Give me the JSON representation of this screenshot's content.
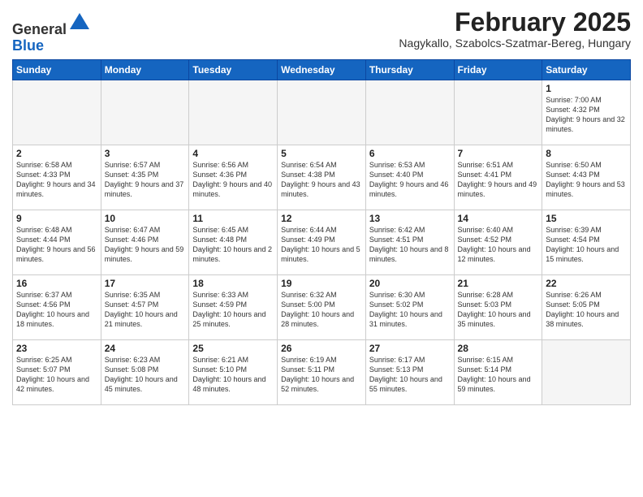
{
  "logo": {
    "general": "General",
    "blue": "Blue"
  },
  "header": {
    "title": "February 2025",
    "subtitle": "Nagykallo, Szabolcs-Szatmar-Bereg, Hungary"
  },
  "weekdays": [
    "Sunday",
    "Monday",
    "Tuesday",
    "Wednesday",
    "Thursday",
    "Friday",
    "Saturday"
  ],
  "weeks": [
    [
      {
        "day": "",
        "info": ""
      },
      {
        "day": "",
        "info": ""
      },
      {
        "day": "",
        "info": ""
      },
      {
        "day": "",
        "info": ""
      },
      {
        "day": "",
        "info": ""
      },
      {
        "day": "",
        "info": ""
      },
      {
        "day": "1",
        "info": "Sunrise: 7:00 AM\nSunset: 4:32 PM\nDaylight: 9 hours and 32 minutes."
      }
    ],
    [
      {
        "day": "2",
        "info": "Sunrise: 6:58 AM\nSunset: 4:33 PM\nDaylight: 9 hours and 34 minutes."
      },
      {
        "day": "3",
        "info": "Sunrise: 6:57 AM\nSunset: 4:35 PM\nDaylight: 9 hours and 37 minutes."
      },
      {
        "day": "4",
        "info": "Sunrise: 6:56 AM\nSunset: 4:36 PM\nDaylight: 9 hours and 40 minutes."
      },
      {
        "day": "5",
        "info": "Sunrise: 6:54 AM\nSunset: 4:38 PM\nDaylight: 9 hours and 43 minutes."
      },
      {
        "day": "6",
        "info": "Sunrise: 6:53 AM\nSunset: 4:40 PM\nDaylight: 9 hours and 46 minutes."
      },
      {
        "day": "7",
        "info": "Sunrise: 6:51 AM\nSunset: 4:41 PM\nDaylight: 9 hours and 49 minutes."
      },
      {
        "day": "8",
        "info": "Sunrise: 6:50 AM\nSunset: 4:43 PM\nDaylight: 9 hours and 53 minutes."
      }
    ],
    [
      {
        "day": "9",
        "info": "Sunrise: 6:48 AM\nSunset: 4:44 PM\nDaylight: 9 hours and 56 minutes."
      },
      {
        "day": "10",
        "info": "Sunrise: 6:47 AM\nSunset: 4:46 PM\nDaylight: 9 hours and 59 minutes."
      },
      {
        "day": "11",
        "info": "Sunrise: 6:45 AM\nSunset: 4:48 PM\nDaylight: 10 hours and 2 minutes."
      },
      {
        "day": "12",
        "info": "Sunrise: 6:44 AM\nSunset: 4:49 PM\nDaylight: 10 hours and 5 minutes."
      },
      {
        "day": "13",
        "info": "Sunrise: 6:42 AM\nSunset: 4:51 PM\nDaylight: 10 hours and 8 minutes."
      },
      {
        "day": "14",
        "info": "Sunrise: 6:40 AM\nSunset: 4:52 PM\nDaylight: 10 hours and 12 minutes."
      },
      {
        "day": "15",
        "info": "Sunrise: 6:39 AM\nSunset: 4:54 PM\nDaylight: 10 hours and 15 minutes."
      }
    ],
    [
      {
        "day": "16",
        "info": "Sunrise: 6:37 AM\nSunset: 4:56 PM\nDaylight: 10 hours and 18 minutes."
      },
      {
        "day": "17",
        "info": "Sunrise: 6:35 AM\nSunset: 4:57 PM\nDaylight: 10 hours and 21 minutes."
      },
      {
        "day": "18",
        "info": "Sunrise: 6:33 AM\nSunset: 4:59 PM\nDaylight: 10 hours and 25 minutes."
      },
      {
        "day": "19",
        "info": "Sunrise: 6:32 AM\nSunset: 5:00 PM\nDaylight: 10 hours and 28 minutes."
      },
      {
        "day": "20",
        "info": "Sunrise: 6:30 AM\nSunset: 5:02 PM\nDaylight: 10 hours and 31 minutes."
      },
      {
        "day": "21",
        "info": "Sunrise: 6:28 AM\nSunset: 5:03 PM\nDaylight: 10 hours and 35 minutes."
      },
      {
        "day": "22",
        "info": "Sunrise: 6:26 AM\nSunset: 5:05 PM\nDaylight: 10 hours and 38 minutes."
      }
    ],
    [
      {
        "day": "23",
        "info": "Sunrise: 6:25 AM\nSunset: 5:07 PM\nDaylight: 10 hours and 42 minutes."
      },
      {
        "day": "24",
        "info": "Sunrise: 6:23 AM\nSunset: 5:08 PM\nDaylight: 10 hours and 45 minutes."
      },
      {
        "day": "25",
        "info": "Sunrise: 6:21 AM\nSunset: 5:10 PM\nDaylight: 10 hours and 48 minutes."
      },
      {
        "day": "26",
        "info": "Sunrise: 6:19 AM\nSunset: 5:11 PM\nDaylight: 10 hours and 52 minutes."
      },
      {
        "day": "27",
        "info": "Sunrise: 6:17 AM\nSunset: 5:13 PM\nDaylight: 10 hours and 55 minutes."
      },
      {
        "day": "28",
        "info": "Sunrise: 6:15 AM\nSunset: 5:14 PM\nDaylight: 10 hours and 59 minutes."
      },
      {
        "day": "",
        "info": ""
      }
    ]
  ]
}
